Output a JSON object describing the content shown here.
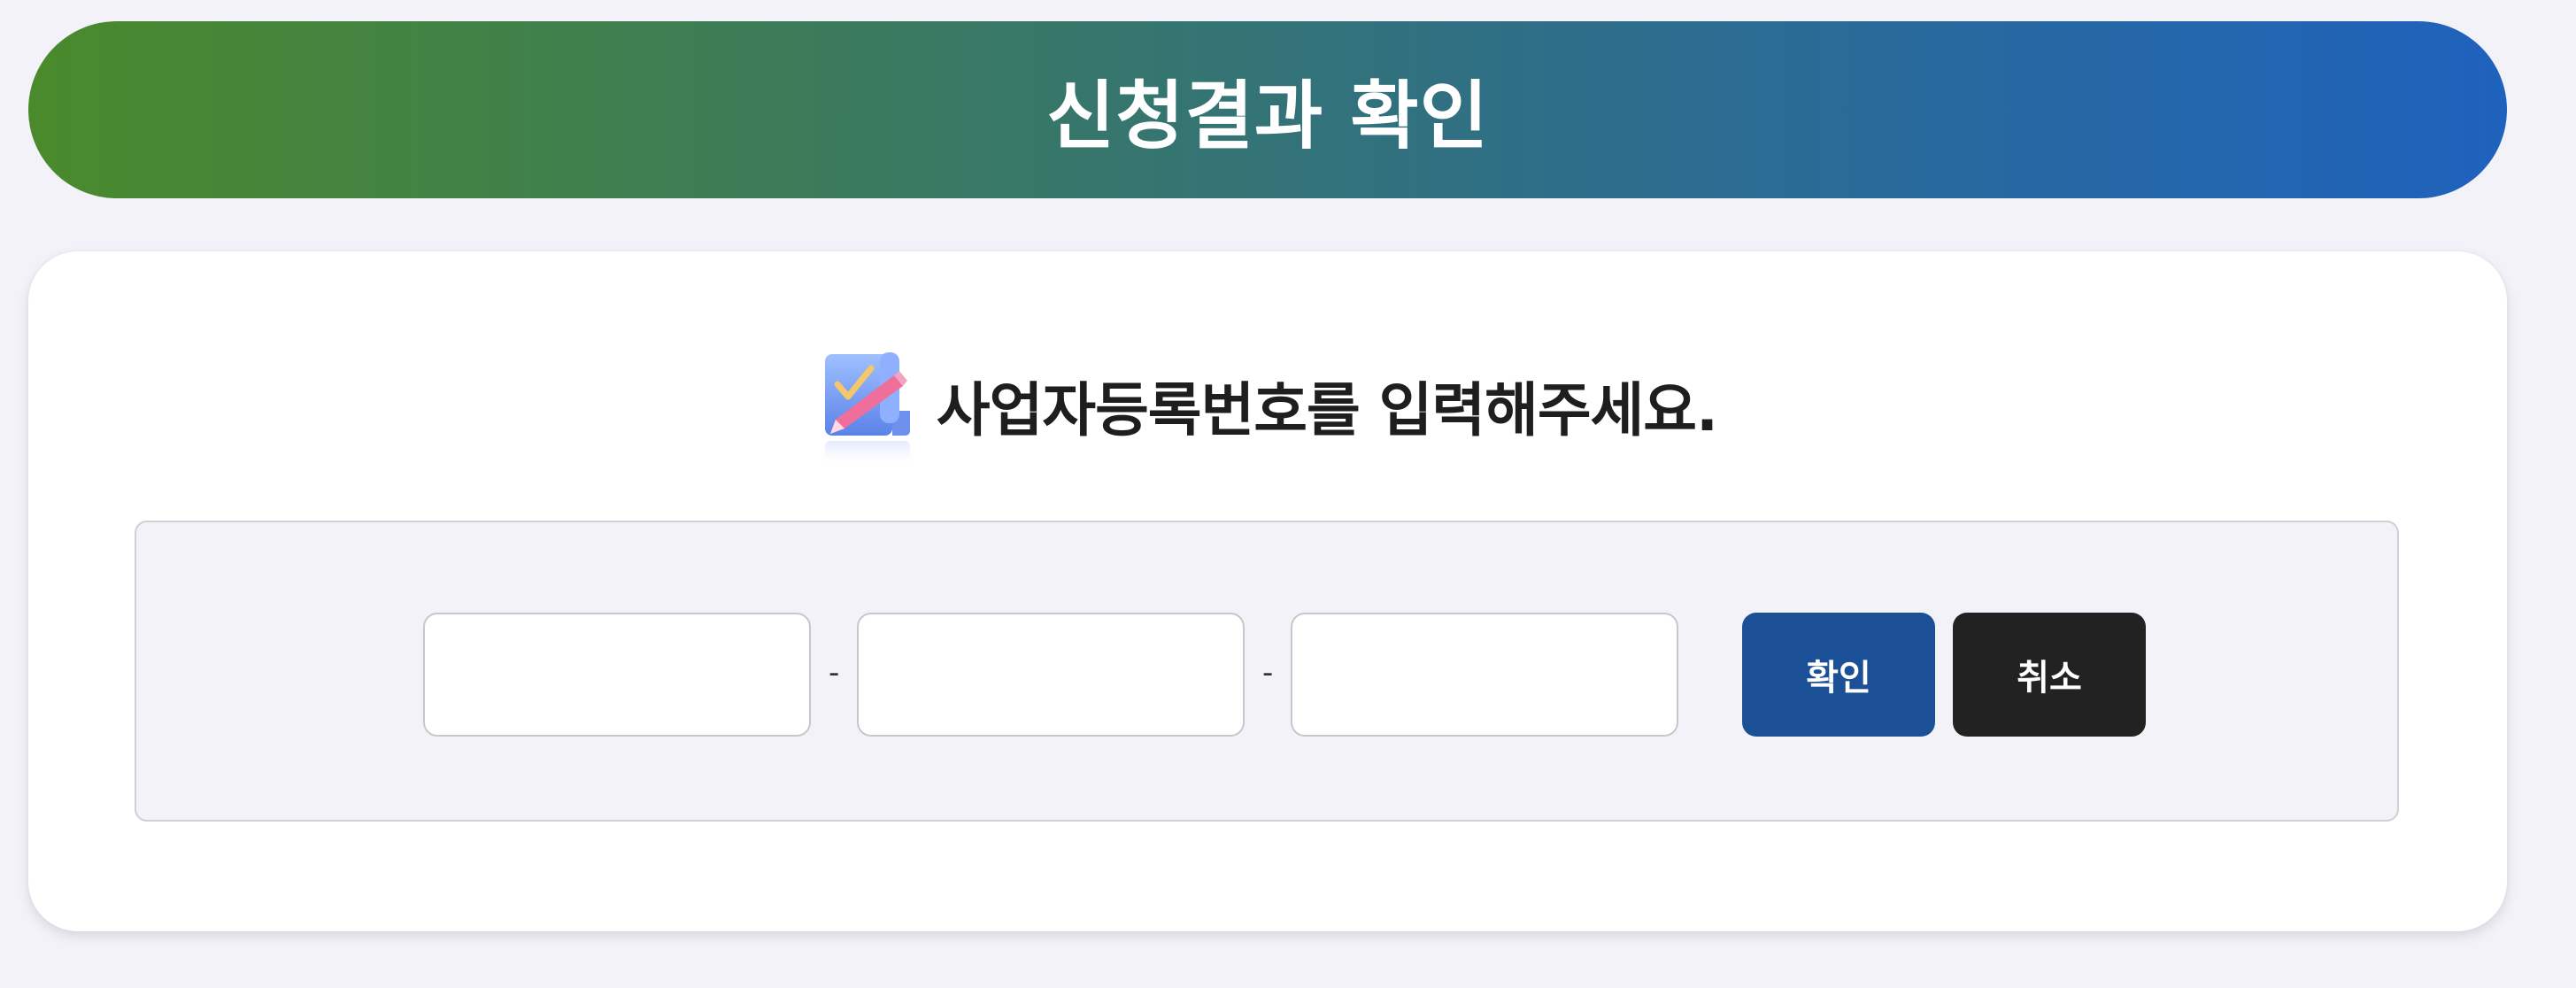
{
  "header": {
    "title": "신청결과 확인"
  },
  "prompt": {
    "icon": "checklist-pencil-icon",
    "text": "사업자등록번호를 입력해주세요."
  },
  "form": {
    "fields": [
      {
        "value": "",
        "placeholder": ""
      },
      {
        "value": "",
        "placeholder": ""
      },
      {
        "value": "",
        "placeholder": ""
      }
    ],
    "separator": "-",
    "confirm_label": "확인",
    "cancel_label": "취소"
  },
  "colors": {
    "header_gradient_start": "#4a8a2c",
    "header_gradient_end": "#1f62bd",
    "confirm_button": "#1b4f96",
    "cancel_button": "#222222",
    "page_background": "#f3f2f8"
  }
}
